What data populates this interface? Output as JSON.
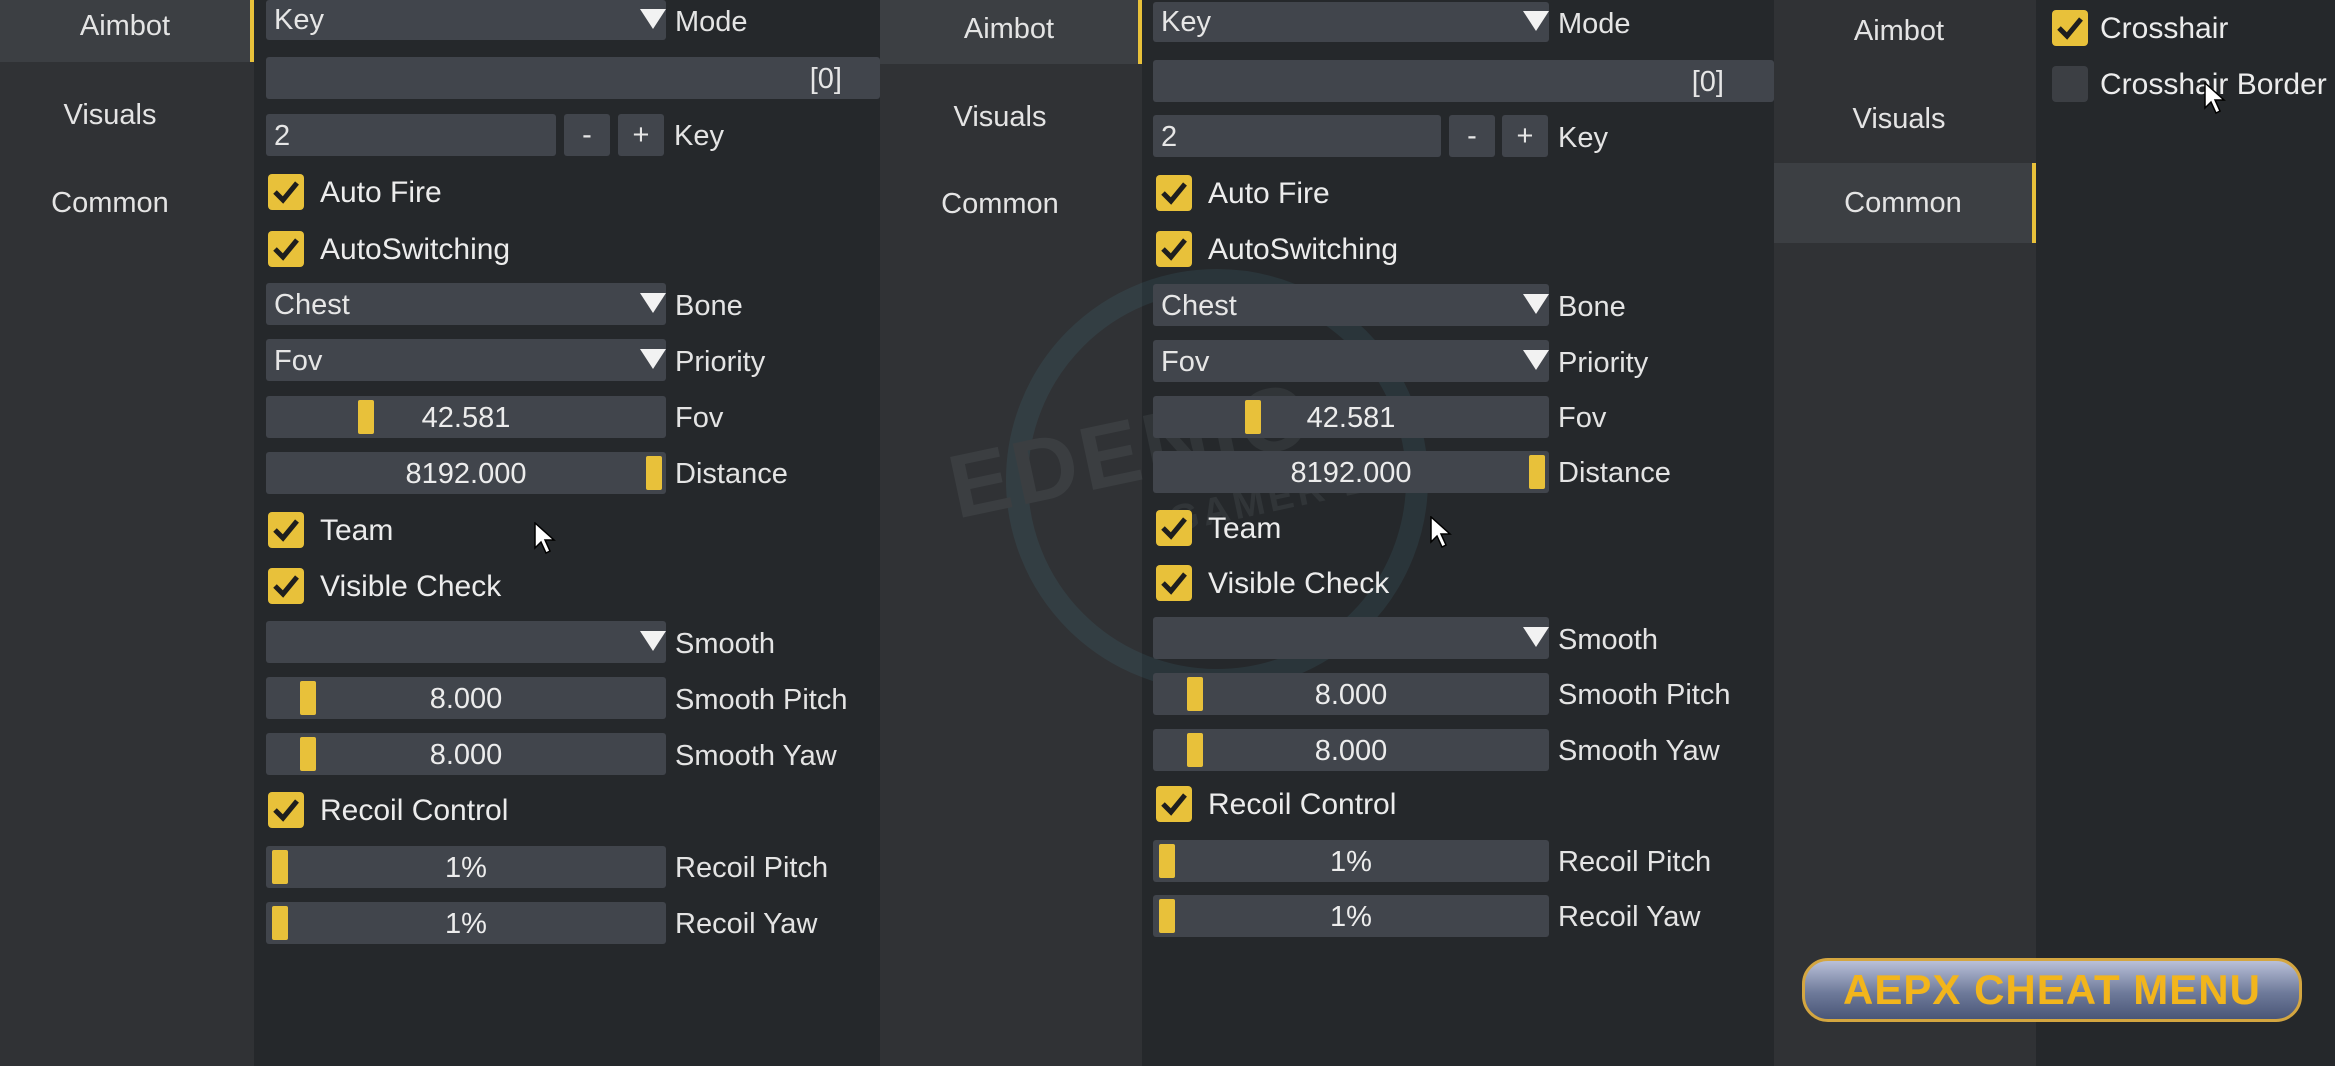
{
  "tabs": [
    "Aimbot",
    "Visuals",
    "Common"
  ],
  "aimbot": {
    "key_mode": {
      "value": "Key",
      "label": "Mode"
    },
    "key_array": "[0]",
    "key_stepper": {
      "value": "2",
      "minus": "-",
      "plus": "+",
      "label": "Key"
    },
    "auto_fire": {
      "label": "Auto Fire",
      "checked": true
    },
    "auto_switching": {
      "label": "AutoSwitching",
      "checked": true
    },
    "bone": {
      "value": "Chest",
      "label": "Bone"
    },
    "priority": {
      "value": "Fov",
      "label": "Priority"
    },
    "fov": {
      "value": "42.581",
      "label": "Fov"
    },
    "distance": {
      "value": "8192.000",
      "label": "Distance"
    },
    "team": {
      "label": "Team",
      "checked": true
    },
    "visible_check": {
      "label": "Visible Check",
      "checked": true
    },
    "smooth": {
      "value": "",
      "label": "Smooth"
    },
    "smooth_pitch": {
      "value": "8.000",
      "label": "Smooth Pitch"
    },
    "smooth_yaw": {
      "value": "8.000",
      "label": "Smooth Yaw"
    },
    "recoil_control": {
      "label": "Recoil Control",
      "checked": true
    },
    "recoil_pitch": {
      "value": "1%",
      "label": "Recoil Pitch"
    },
    "recoil_yaw": {
      "value": "1%",
      "label": "Recoil Yaw"
    }
  },
  "common": {
    "crosshair": {
      "label": "Crosshair",
      "checked": true
    },
    "crosshair_border": {
      "label": "Crosshair Border",
      "checked": false
    }
  },
  "watermark": {
    "main": "EDENIO",
    "sub": "GAMER BOY"
  },
  "banner": "AEPX CHEAT MENU",
  "colors": {
    "accent": "#e8c13a",
    "panel": "#303235",
    "background": "#25282b",
    "field": "#41454c"
  }
}
